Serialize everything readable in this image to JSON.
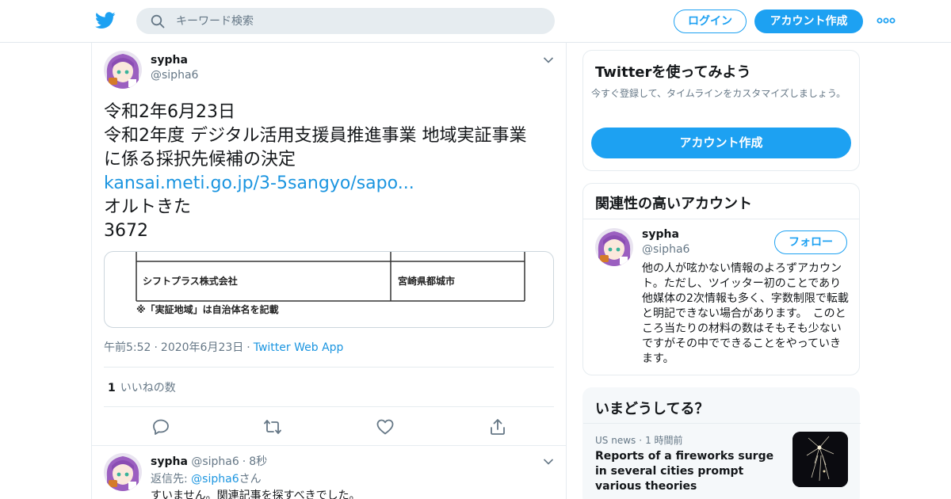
{
  "nav": {
    "search_placeholder": "キーワード検索",
    "login_label": "ログイン",
    "signup_label": "アカウント作成",
    "brand_color": "#1da1f2",
    "icons": [
      "twitter-bird-icon",
      "search-icon",
      "more-dots-icon"
    ]
  },
  "tweet": {
    "author_name": "sypha",
    "author_handle": "@sipha6",
    "lines": [
      "令和2年6月23日",
      "令和2年度 デジタル活用支援員推進事業 地域実証事業",
      "に係る採択先候補の決定"
    ],
    "link_text": "kansai.meti.go.jp/3-5sangyo/sapo...",
    "after_lines": [
      "オルトきた",
      "3672"
    ],
    "media": {
      "row_company": "シフトプラス株式会社",
      "row_city": "宮崎県都城市",
      "footnote": "※「実証地域」は自治体名を記載"
    },
    "time": "午前5:52",
    "date": "2020年6月23日",
    "source": "Twitter Web App",
    "likes_count": "1",
    "likes_label": "いいねの数"
  },
  "reply": {
    "author_name": "sypha",
    "author_handle": "@sipha6",
    "age": "8秒",
    "reply_to_label": "返信先:",
    "reply_to_handle": "@sipha6",
    "reply_to_suffix": "さん",
    "text": "すいません。関連記事を探すべきでした。"
  },
  "sidebar": {
    "signup_card": {
      "title": "Twitterを使ってみよう",
      "subtitle": "今すぐ登録して、タイムラインをカスタマイズしましょう。",
      "button_label": "アカウント作成"
    },
    "related_card": {
      "title": "関連性の高いアカウント",
      "name": "sypha",
      "handle": "@sipha6",
      "follow_label": "フォロー",
      "bio": "他の人が呟かない情報のよろずアカウント。ただし、ツイッター初のことであり他媒体の2次情報も多く、字数制限で転載と明記できない場合があります。　このところ当たりの材料の数はそもそも少ないですがその中でできることをやっていきます。"
    },
    "trends_card": {
      "title": "いまどうしてる？",
      "category": "US news",
      "age": "1 時間前",
      "headline": "Reports of a fireworks surge in several cities prompt various theories"
    }
  }
}
